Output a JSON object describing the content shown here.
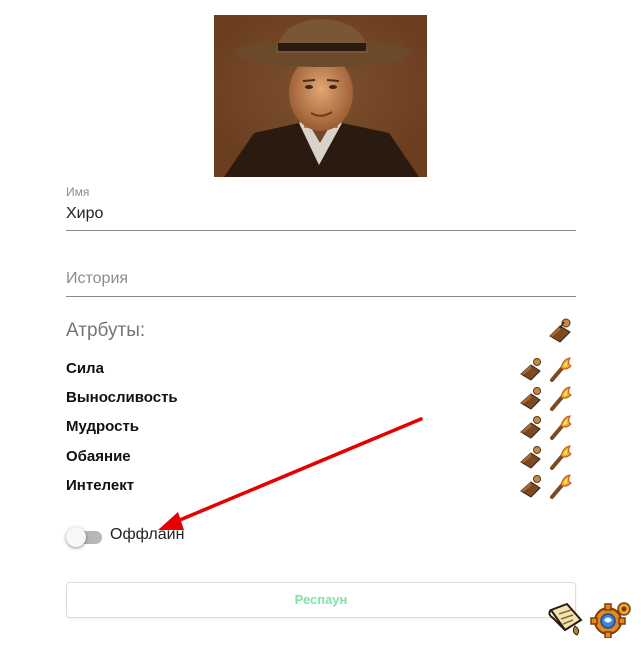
{
  "profile": {
    "portrait_alt": "portrait"
  },
  "form": {
    "name_label": "Имя",
    "name_value": "Хиро",
    "history_placeholder": "История"
  },
  "attributes": {
    "title": "Атрбуты:",
    "items": [
      {
        "label": "Сила"
      },
      {
        "label": "Выносливость"
      },
      {
        "label": "Мудрость"
      },
      {
        "label": "Обаяние"
      },
      {
        "label": "Интелект"
      }
    ]
  },
  "status": {
    "toggle_label": "Оффлайн",
    "online": false
  },
  "actions": {
    "respawn_label": "Респаун"
  },
  "colors": {
    "accent_green": "#7ee3a8",
    "annotation_red": "#e60000"
  },
  "icons": {
    "attribute_header": "spellbook-icon",
    "attribute_buttons": [
      "spellbook-icon",
      "torch-icon"
    ],
    "corner": [
      "scroll-icon",
      "gear-icon"
    ]
  }
}
